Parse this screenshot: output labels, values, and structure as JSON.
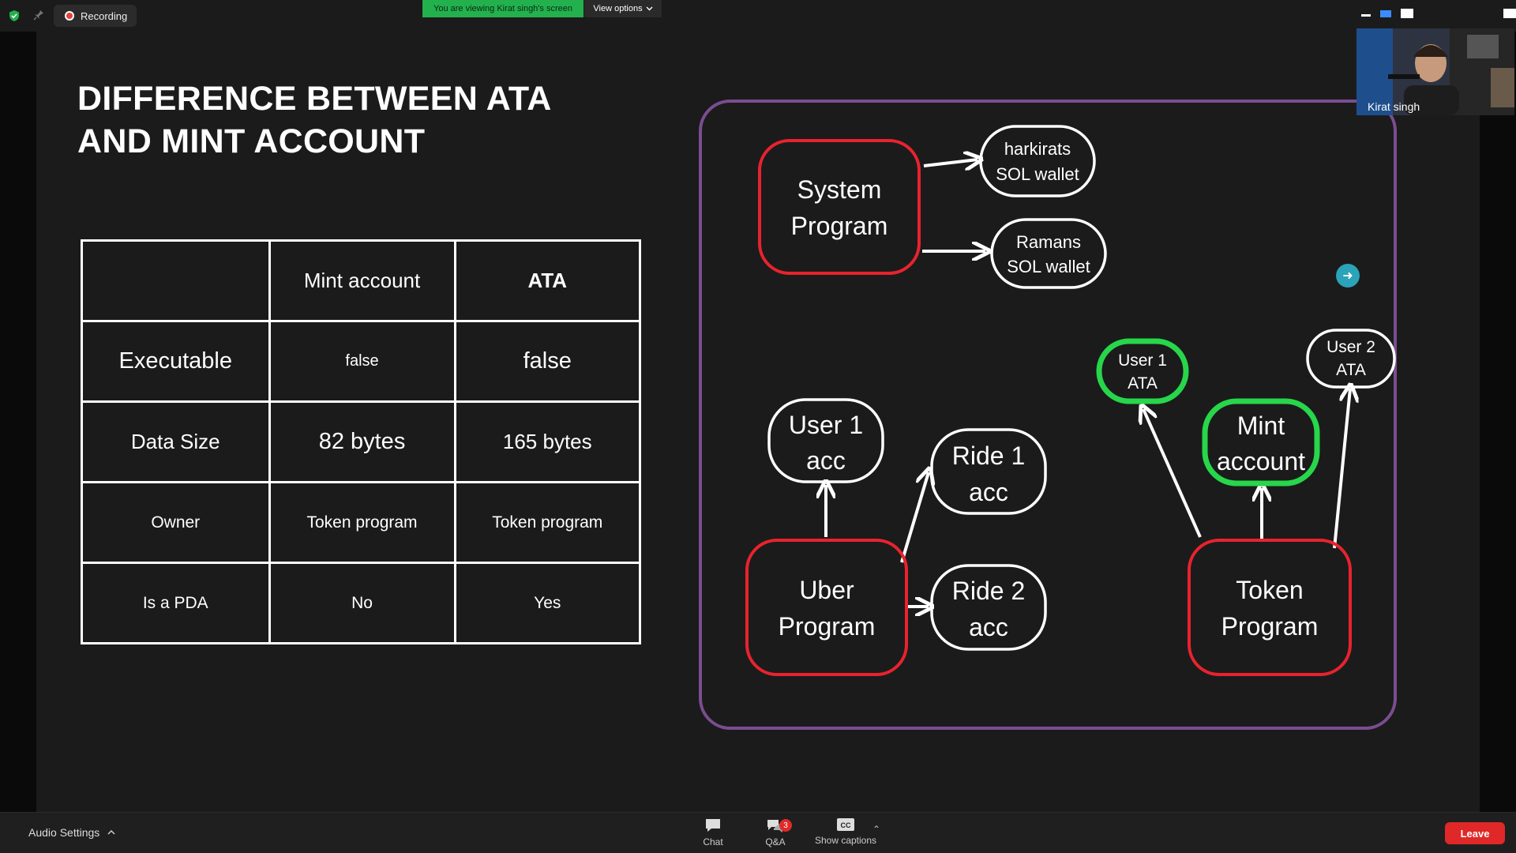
{
  "topbar": {
    "recording_label": "Recording",
    "viewing_banner": "You are viewing Kirat singh's screen",
    "view_options_label": "View options"
  },
  "participant": {
    "name": "Kirat singh"
  },
  "slide": {
    "title_line1": "DIFFERENCE BETWEEN ATA",
    "title_line2": "AND MINT ACCOUNT",
    "table": {
      "headers": [
        "",
        "Mint account",
        "ATA"
      ],
      "rows": [
        [
          "Executable",
          "false",
          "false"
        ],
        [
          "Data Size",
          "82 bytes",
          "165 bytes"
        ],
        [
          "Owner",
          "Token program",
          "Token program"
        ],
        [
          "Is a PDA",
          "No",
          "Yes"
        ]
      ]
    },
    "diagram": {
      "system_program": [
        "System",
        "Program"
      ],
      "harkirats_wallet": [
        "harkirats",
        "SOL wallet"
      ],
      "ramans_wallet": [
        "Ramans",
        "SOL wallet"
      ],
      "user1_acc": [
        "User 1",
        "acc"
      ],
      "ride1_acc": [
        "Ride 1",
        "acc"
      ],
      "ride2_acc": [
        "Ride 2",
        "acc"
      ],
      "uber_program": [
        "Uber",
        "Program"
      ],
      "user1_ata": [
        "User 1",
        "ATA"
      ],
      "user2_ata": [
        "User 2",
        "ATA"
      ],
      "mint_account": [
        "Mint",
        "account"
      ],
      "token_program": [
        "Token",
        "Program"
      ]
    }
  },
  "bottombar": {
    "audio_settings": "Audio Settings",
    "chat_label": "Chat",
    "qa_label": "Q&A",
    "qa_badge": "3",
    "captions_label": "Show captions",
    "captions_icon_text": "CC",
    "leave_label": "Leave"
  },
  "colors": {
    "program_border": "#e8232e",
    "highlight_border": "#27d64a",
    "container_border": "#7a4d90",
    "banner_green": "#23b14d",
    "leave_red": "#e02828"
  }
}
